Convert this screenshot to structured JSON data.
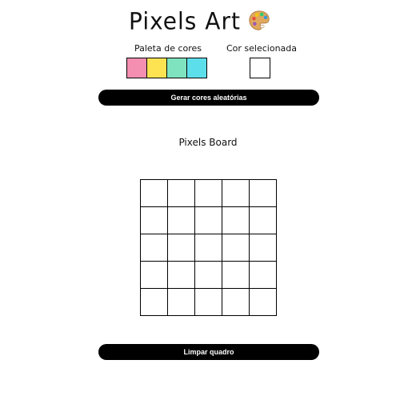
{
  "header": {
    "title": "Pixels Art",
    "icon": "artist-palette-icon"
  },
  "palette": {
    "label": "Paleta de cores",
    "colors": [
      "#f48fb1",
      "#fde352",
      "#7fe3bf",
      "#5ddfeb"
    ]
  },
  "selected": {
    "label": "Cor selecionada",
    "color": "#ffffff"
  },
  "buttons": {
    "random_label": "Gerar cores aleatórias",
    "clear_label": "Limpar quadro"
  },
  "board": {
    "title": "Pixels Board",
    "rows": 5,
    "cols": 5,
    "pixel_color": "#ffffff"
  }
}
